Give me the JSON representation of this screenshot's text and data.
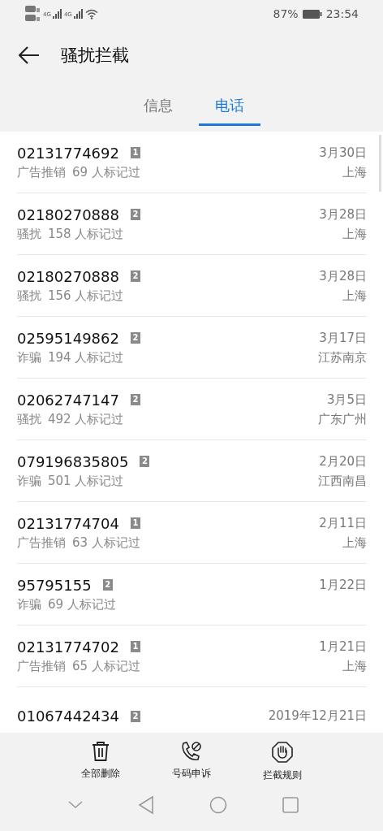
{
  "status_bar": {
    "battery": "87%",
    "time": "23:54",
    "network_1": "4G",
    "network_2": "4G"
  },
  "header": {
    "title": "骚扰拦截"
  },
  "tabs": [
    {
      "label": "信息",
      "selected": false
    },
    {
      "label": "电话",
      "selected": true
    }
  ],
  "calls": [
    {
      "number": "02131774692",
      "sim": "1",
      "category": "广告推销",
      "reports": "69 人标记过",
      "date": "3月30日",
      "location": "上海"
    },
    {
      "number": "02180270888",
      "sim": "2",
      "category": "骚扰",
      "reports": "158 人标记过",
      "date": "3月28日",
      "location": "上海"
    },
    {
      "number": "02180270888",
      "sim": "2",
      "category": "骚扰",
      "reports": "156 人标记过",
      "date": "3月28日",
      "location": "上海"
    },
    {
      "number": "02595149862",
      "sim": "2",
      "category": "诈骗",
      "reports": "194 人标记过",
      "date": "3月17日",
      "location": "江苏南京"
    },
    {
      "number": "02062747147",
      "sim": "2",
      "category": "骚扰",
      "reports": "492 人标记过",
      "date": "3月5日",
      "location": "广东广州"
    },
    {
      "number": "079196835805",
      "sim": "2",
      "category": "诈骗",
      "reports": "501 人标记过",
      "date": "2月20日",
      "location": "江西南昌"
    },
    {
      "number": "02131774704",
      "sim": "1",
      "category": "广告推销",
      "reports": "63 人标记过",
      "date": "2月11日",
      "location": "上海"
    },
    {
      "number": "95795155",
      "sim": "2",
      "category": "诈骗",
      "reports": "69 人标记过",
      "date": "1月22日"
    },
    {
      "number": "02131774702",
      "sim": "1",
      "category": "广告推销",
      "reports": "65 人标记过",
      "date": "1月21日",
      "location": "上海"
    },
    {
      "number": "01067442434",
      "sim": "2",
      "date": "2019年12月21日"
    }
  ],
  "actions": [
    {
      "kind": "delete",
      "label": "全部删除"
    },
    {
      "kind": "appeal",
      "label": "号码申诉"
    },
    {
      "kind": "rules",
      "label": "拦截规则"
    }
  ]
}
